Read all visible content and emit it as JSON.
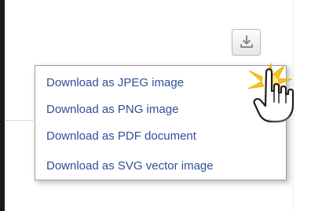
{
  "export_button": {
    "icon": "download-icon",
    "accent_color": "#8b8b8b"
  },
  "menu": {
    "items": [
      {
        "label": "Download as JPEG image"
      },
      {
        "label": "Download as PNG image"
      },
      {
        "label": "Download as PDF document"
      },
      {
        "label": "Download as SVG vector image"
      }
    ],
    "text_color": "#2f4f9a"
  },
  "cursor": {
    "icon": "hand-pointer-icon",
    "click_effect": "yellow-click-burst-icon"
  }
}
